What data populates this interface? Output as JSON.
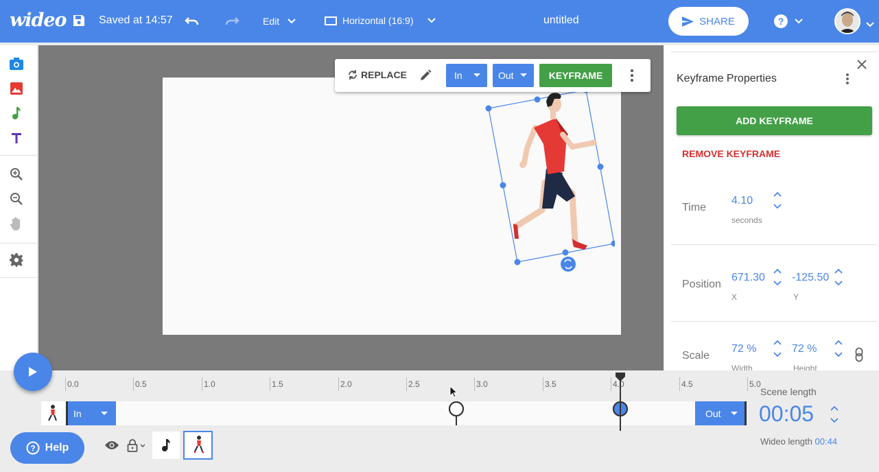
{
  "topbar": {
    "logo": "wideo",
    "saved_text": "Saved at 14:57",
    "edit_label": "Edit",
    "format_label": "Horizontal (16:9)",
    "doc_title": "untitled",
    "share_label": "SHARE"
  },
  "toolbar": {
    "replace_label": "REPLACE",
    "in_label": "In",
    "out_label": "Out",
    "keyframe_label": "KEYFRAME"
  },
  "panel": {
    "title": "Keyframe Properties",
    "add_keyframe": "ADD KEYFRAME",
    "remove_keyframe": "REMOVE KEYFRAME",
    "time_label": "Time",
    "time_value": "4.10",
    "time_unit": "seconds",
    "position_label": "Position",
    "pos_x": "671.30",
    "pos_x_label": "X",
    "pos_y": "-125.50",
    "pos_y_label": "Y",
    "scale_label": "Scale",
    "scale_w": "72 %",
    "scale_w_label": "Width",
    "scale_h": "72 %",
    "scale_h_label": "Height"
  },
  "timeline": {
    "ticks": [
      "0.0",
      "0.5",
      "1.0",
      "1.5",
      "2.0",
      "2.5",
      "3.0",
      "3.5",
      "4.0",
      "4.5",
      "5.0"
    ],
    "in_label": "In",
    "out_label": "Out",
    "scene_length_label": "Scene length",
    "scene_length_value": "00:05",
    "wideo_length_label": "Wideo length",
    "wideo_length_value": "00:44"
  },
  "help_label": "Help",
  "colors": {
    "accent": "#4a86e8",
    "green": "#43a047",
    "red": "#d32f2f"
  }
}
